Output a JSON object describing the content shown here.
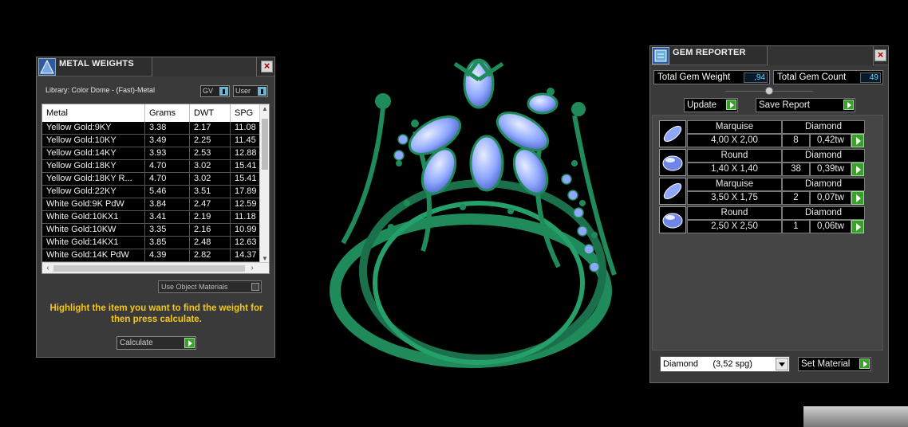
{
  "metal_weights": {
    "title": "METAL WEIGHTS",
    "library_label": "Library: Color Dome - (Fast)-Metal",
    "gv_select": "GV",
    "user_select": "User",
    "columns": [
      "Metal",
      "Grams",
      "DWT",
      "SPG"
    ],
    "rows": [
      [
        "Yellow Gold:9KY",
        "3.38",
        "2.17",
        "11.08"
      ],
      [
        "Yellow Gold:10KY",
        "3.49",
        "2.25",
        "11.45"
      ],
      [
        "Yellow Gold:14KY",
        "3.93",
        "2.53",
        "12.88"
      ],
      [
        "Yellow Gold:18KY",
        "4.70",
        "3.02",
        "15.41"
      ],
      [
        "Yellow Gold:18KY R...",
        "4.70",
        "3.02",
        "15.41"
      ],
      [
        "Yellow Gold:22KY",
        "5.46",
        "3.51",
        "17.89"
      ],
      [
        "White Gold:9K PdW",
        "3.84",
        "2.47",
        "12.59"
      ],
      [
        "White Gold:10KX1",
        "3.41",
        "2.19",
        "11.18"
      ],
      [
        "White Gold:10KW",
        "3.35",
        "2.16",
        "10.99"
      ],
      [
        "White Gold:14KX1",
        "3.85",
        "2.48",
        "12.63"
      ],
      [
        "White Gold:14K PdW",
        "4.39",
        "2.82",
        "14.37"
      ]
    ],
    "use_object_materials": "Use Object Materials",
    "hint": "Highlight the item you want to find the weight for then press calculate.",
    "calculate_label": "Calculate"
  },
  "gem_reporter": {
    "title": "GEM REPORTER",
    "total_weight_label": "Total Gem Weight",
    "total_weight_value": ",94",
    "total_count_label": "Total Gem Count",
    "total_count_value": "49",
    "update_label": "Update",
    "save_report_label": "Save Report",
    "gems": [
      {
        "shape": "Marquise",
        "material": "Diamond",
        "size": "4,00 X 2,00",
        "count": "8",
        "weight": "0,42tw"
      },
      {
        "shape": "Round",
        "material": "Diamond",
        "size": "1,40 X 1,40",
        "count": "38",
        "weight": "0,39tw"
      },
      {
        "shape": "Marquise",
        "material": "Diamond",
        "size": "3,50 X 1,75",
        "count": "2",
        "weight": "0,07tw"
      },
      {
        "shape": "Round",
        "material": "Diamond",
        "size": "2,50 X 2,50",
        "count": "1",
        "weight": "0,06tw"
      }
    ],
    "material_select": "Diamond      (3,52 spg)",
    "set_material_label": "Set Material"
  },
  "colors": {
    "ring_green": "#1f8a5a",
    "gem_blue": "#8fa8ff",
    "hint_yellow": "#f4c81a",
    "value_cyan": "#5dd3ff"
  }
}
